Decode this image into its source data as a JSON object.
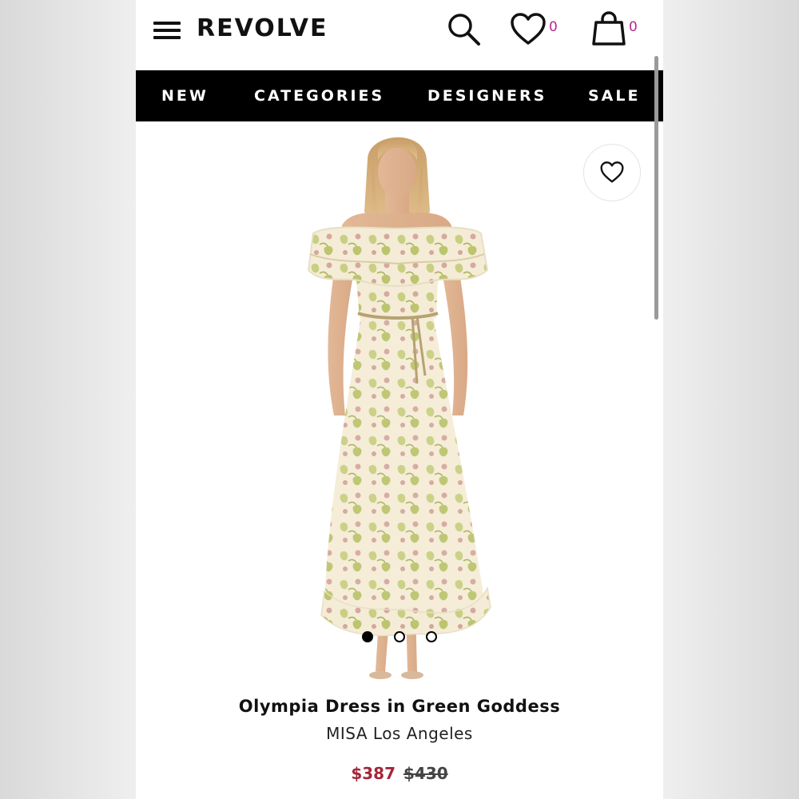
{
  "header": {
    "logo": "REVOLVE",
    "wishlist_count": "0",
    "cart_count": "0",
    "accent_color": "#b5288f"
  },
  "nav": {
    "items": [
      {
        "label": "NEW"
      },
      {
        "label": "CATEGORIES"
      },
      {
        "label": "DESIGNERS"
      },
      {
        "label": "SALE"
      }
    ]
  },
  "icons": {
    "menu": "hamburger-menu-icon",
    "search": "search-icon",
    "wishlist": "heart-icon",
    "cart": "shopping-bag-icon",
    "favorite": "heart-outline-icon"
  },
  "gallery": {
    "image_count": 3,
    "active_index": 0
  },
  "product": {
    "title": "Olympia Dress in Green Goddess",
    "brand": "MISA Los Angeles",
    "sale_price": "$387",
    "original_price": "$430",
    "sale_color": "#a3263a"
  }
}
